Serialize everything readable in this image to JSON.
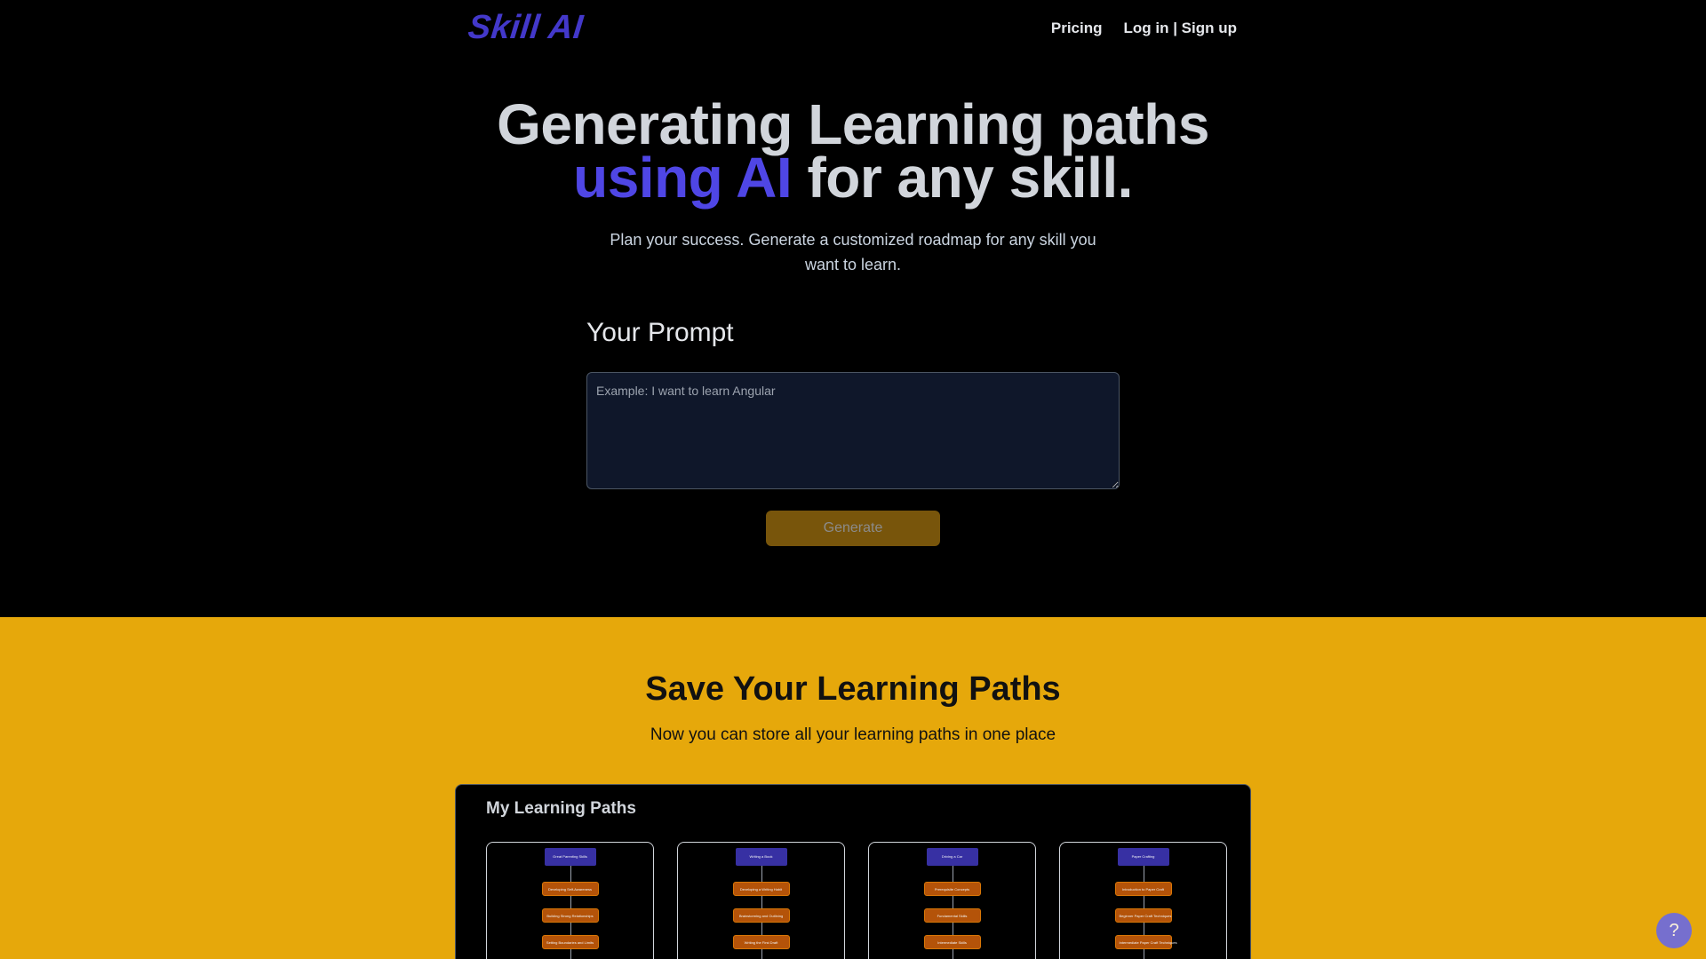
{
  "nav": {
    "logo": "Skill AI",
    "pricing": "Pricing",
    "login": "Log in | Sign up"
  },
  "hero": {
    "title_line1": "Generating Learning paths",
    "title_accent": "using AI",
    "title_rest": " for any skill.",
    "subtitle": "Plan your success. Generate a customized roadmap for any skill you want to learn."
  },
  "prompt": {
    "label": "Your Prompt",
    "placeholder": "Example: I want to learn Angular",
    "button": "Generate"
  },
  "save": {
    "title": "Save Your Learning Paths",
    "subtitle": "Now you can store all your learning paths in one place"
  },
  "panel": {
    "title": "My Learning Paths",
    "cards": [
      {
        "root": "Great Parenting Skills",
        "steps": [
          "Developing Self-Awareness",
          "Building Strong Relationships",
          "Setting Boundaries and Limits"
        ]
      },
      {
        "root": "Writing a Book",
        "steps": [
          "Developing a Writing Habit",
          "Brainstorming and Outlining",
          "Writing the First Draft"
        ]
      },
      {
        "root": "Driving a Car",
        "steps": [
          "Prerequisite Concepts",
          "Fundamental Skills",
          "Intermediate Skills"
        ]
      },
      {
        "root": "Paper Crafting",
        "steps": [
          "Introduction to Paper Craft",
          "Beginner Paper Craft Techniques",
          "Intermediate Paper Craft Techniques"
        ]
      }
    ]
  },
  "help": "?",
  "colors": {
    "accent": "#4f46e5",
    "yellow": "#e6a80b",
    "button": "#78550b"
  }
}
